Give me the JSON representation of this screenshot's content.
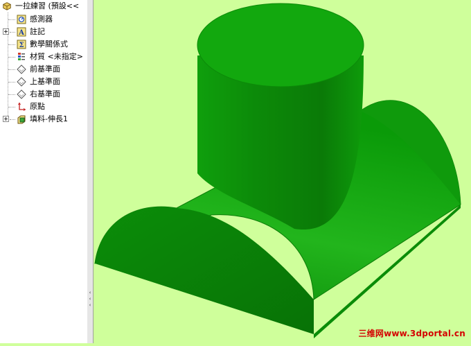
{
  "tree": {
    "part_name": "一拉練習 (預設<<",
    "items": [
      {
        "label": "感測器",
        "icon": "sensor-icon",
        "expandable": false
      },
      {
        "label": "註記",
        "icon": "annotation-icon",
        "expandable": true
      },
      {
        "label": "數學關係式",
        "icon": "equation-icon",
        "expandable": false
      },
      {
        "label": "材質 <未指定>",
        "icon": "material-icon",
        "expandable": false
      },
      {
        "label": "前基準面",
        "icon": "plane-icon",
        "expandable": false
      },
      {
        "label": "上基準面",
        "icon": "plane-icon",
        "expandable": false
      },
      {
        "label": "右基準面",
        "icon": "plane-icon",
        "expandable": false
      },
      {
        "label": "原點",
        "icon": "origin-icon",
        "expandable": false
      },
      {
        "label": "填料-伸長1",
        "icon": "extrude-icon",
        "expandable": true
      }
    ]
  },
  "splitter_grip": "‹‹‹",
  "watermark": "三维网www.3dportal.cn",
  "colors": {
    "background": "#cfff9b",
    "model_green": "#12a80e",
    "watermark": "#d40000"
  }
}
